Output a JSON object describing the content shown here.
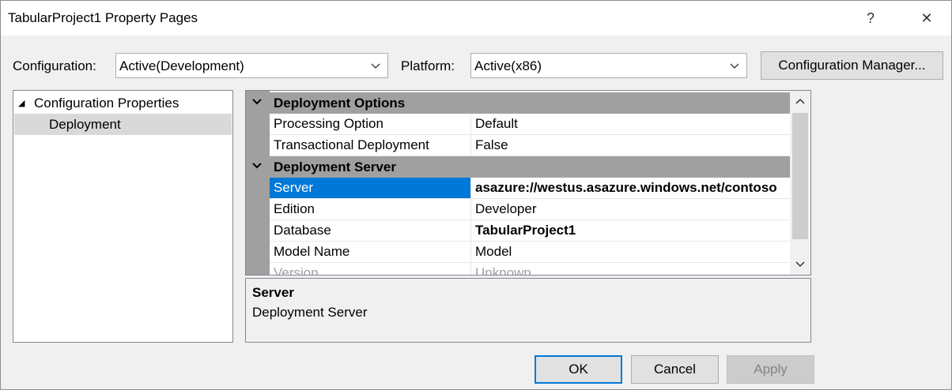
{
  "window": {
    "title": "TabularProject1 Property Pages",
    "help_glyph": "?",
    "close_glyph": "✕"
  },
  "toolbar": {
    "configuration_label": "Configuration:",
    "configuration_value": "Active(Development)",
    "platform_label": "Platform:",
    "platform_value": "Active(x86)",
    "config_manager_label": "Configuration Manager..."
  },
  "tree": {
    "root": "Configuration Properties",
    "root_expander": "◢",
    "children": [
      "Deployment"
    ]
  },
  "grid": {
    "categories": [
      {
        "name": "Deployment Options",
        "properties": [
          {
            "name": "Processing Option",
            "value": "Default"
          },
          {
            "name": "Transactional Deployment",
            "value": "False"
          }
        ]
      },
      {
        "name": "Deployment Server",
        "properties": [
          {
            "name": "Server",
            "value": "asazure://westus.asazure.windows.net/contoso",
            "selected": true,
            "bold": true
          },
          {
            "name": "Edition",
            "value": "Developer"
          },
          {
            "name": "Database",
            "value": "TabularProject1",
            "bold": true
          },
          {
            "name": "Model Name",
            "value": "Model"
          },
          {
            "name": "Version",
            "value": "Unknown",
            "dim": true
          }
        ]
      }
    ]
  },
  "description": {
    "title": "Server",
    "text": "Deployment Server"
  },
  "buttons": {
    "ok": "OK",
    "cancel": "Cancel",
    "apply": "Apply"
  }
}
